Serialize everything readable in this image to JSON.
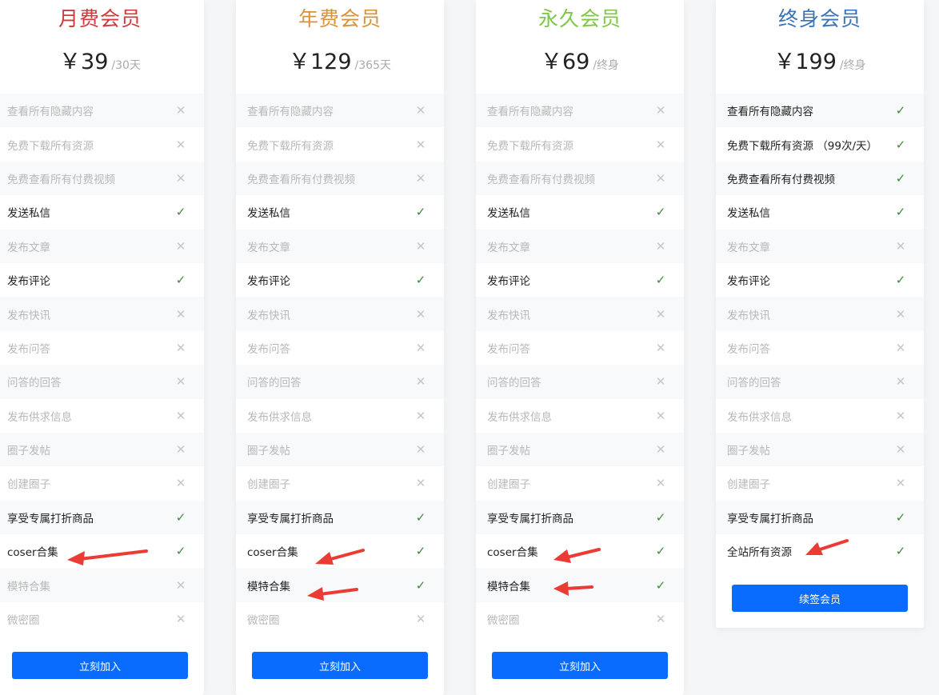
{
  "cards": [
    {
      "title": "月费会员",
      "title_color": "#d0393d",
      "currency": "￥",
      "price": "39",
      "period": "/30天",
      "features": [
        {
          "label": "查看所有隐藏内容",
          "included": false
        },
        {
          "label": "免费下载所有资源",
          "included": false
        },
        {
          "label": "免费查看所有付费视频",
          "included": false
        },
        {
          "label": "发送私信",
          "included": true
        },
        {
          "label": "发布文章",
          "included": false
        },
        {
          "label": "发布评论",
          "included": true
        },
        {
          "label": "发布快讯",
          "included": false
        },
        {
          "label": "发布问答",
          "included": false
        },
        {
          "label": "问答的回答",
          "included": false
        },
        {
          "label": "发布供求信息",
          "included": false
        },
        {
          "label": "圈子发帖",
          "included": false
        },
        {
          "label": "创建圈子",
          "included": false
        },
        {
          "label": "享受专属打折商品",
          "included": true
        },
        {
          "label": "coser合集",
          "included": true
        },
        {
          "label": "模特合集",
          "included": false
        },
        {
          "label": "微密圈",
          "included": false
        }
      ],
      "button": "立刻加入"
    },
    {
      "title": "年费会员",
      "title_color": "#d9923a",
      "currency": "￥",
      "price": "129",
      "period": "/365天",
      "features": [
        {
          "label": "查看所有隐藏内容",
          "included": false
        },
        {
          "label": "免费下载所有资源",
          "included": false
        },
        {
          "label": "免费查看所有付费视频",
          "included": false
        },
        {
          "label": "发送私信",
          "included": true
        },
        {
          "label": "发布文章",
          "included": false
        },
        {
          "label": "发布评论",
          "included": true
        },
        {
          "label": "发布快讯",
          "included": false
        },
        {
          "label": "发布问答",
          "included": false
        },
        {
          "label": "问答的回答",
          "included": false
        },
        {
          "label": "发布供求信息",
          "included": false
        },
        {
          "label": "圈子发帖",
          "included": false
        },
        {
          "label": "创建圈子",
          "included": false
        },
        {
          "label": "享受专属打折商品",
          "included": true
        },
        {
          "label": "coser合集",
          "included": true
        },
        {
          "label": "模特合集",
          "included": true
        },
        {
          "label": "微密圈",
          "included": false
        }
      ],
      "button": "立刻加入"
    },
    {
      "title": "永久会员",
      "title_color": "#7ec843",
      "currency": "￥",
      "price": "69",
      "period": "/终身",
      "features": [
        {
          "label": "查看所有隐藏内容",
          "included": false
        },
        {
          "label": "免费下载所有资源",
          "included": false
        },
        {
          "label": "免费查看所有付费视频",
          "included": false
        },
        {
          "label": "发送私信",
          "included": true
        },
        {
          "label": "发布文章",
          "included": false
        },
        {
          "label": "发布评论",
          "included": true
        },
        {
          "label": "发布快讯",
          "included": false
        },
        {
          "label": "发布问答",
          "included": false
        },
        {
          "label": "问答的回答",
          "included": false
        },
        {
          "label": "发布供求信息",
          "included": false
        },
        {
          "label": "圈子发帖",
          "included": false
        },
        {
          "label": "创建圈子",
          "included": false
        },
        {
          "label": "享受专属打折商品",
          "included": true
        },
        {
          "label": "coser合集",
          "included": true
        },
        {
          "label": "模特合集",
          "included": true
        },
        {
          "label": "微密圈",
          "included": false
        }
      ],
      "button": "立刻加入"
    },
    {
      "title": "终身会员",
      "title_color": "#3b73b9",
      "currency": "￥",
      "price": "199",
      "period": "/终身",
      "features": [
        {
          "label": "查看所有隐藏内容",
          "included": true
        },
        {
          "label": "免费下载所有资源 （99次/天）",
          "included": true
        },
        {
          "label": "免费查看所有付费视频",
          "included": true
        },
        {
          "label": "发送私信",
          "included": true
        },
        {
          "label": "发布文章",
          "included": false
        },
        {
          "label": "发布评论",
          "included": true
        },
        {
          "label": "发布快讯",
          "included": false
        },
        {
          "label": "发布问答",
          "included": false
        },
        {
          "label": "问答的回答",
          "included": false
        },
        {
          "label": "发布供求信息",
          "included": false
        },
        {
          "label": "圈子发帖",
          "included": false
        },
        {
          "label": "创建圈子",
          "included": false
        },
        {
          "label": "享受专属打折商品",
          "included": true
        },
        {
          "label": "全站所有资源",
          "included": true
        }
      ],
      "button": "续签会员"
    }
  ],
  "icons": {
    "check": "check-icon",
    "cross": "close-icon",
    "arrow": "red-arrow-icon"
  },
  "colors": {
    "primary_button": "#0a6cff",
    "check": "#3d8a3d",
    "arrow": "#ea3b34"
  }
}
